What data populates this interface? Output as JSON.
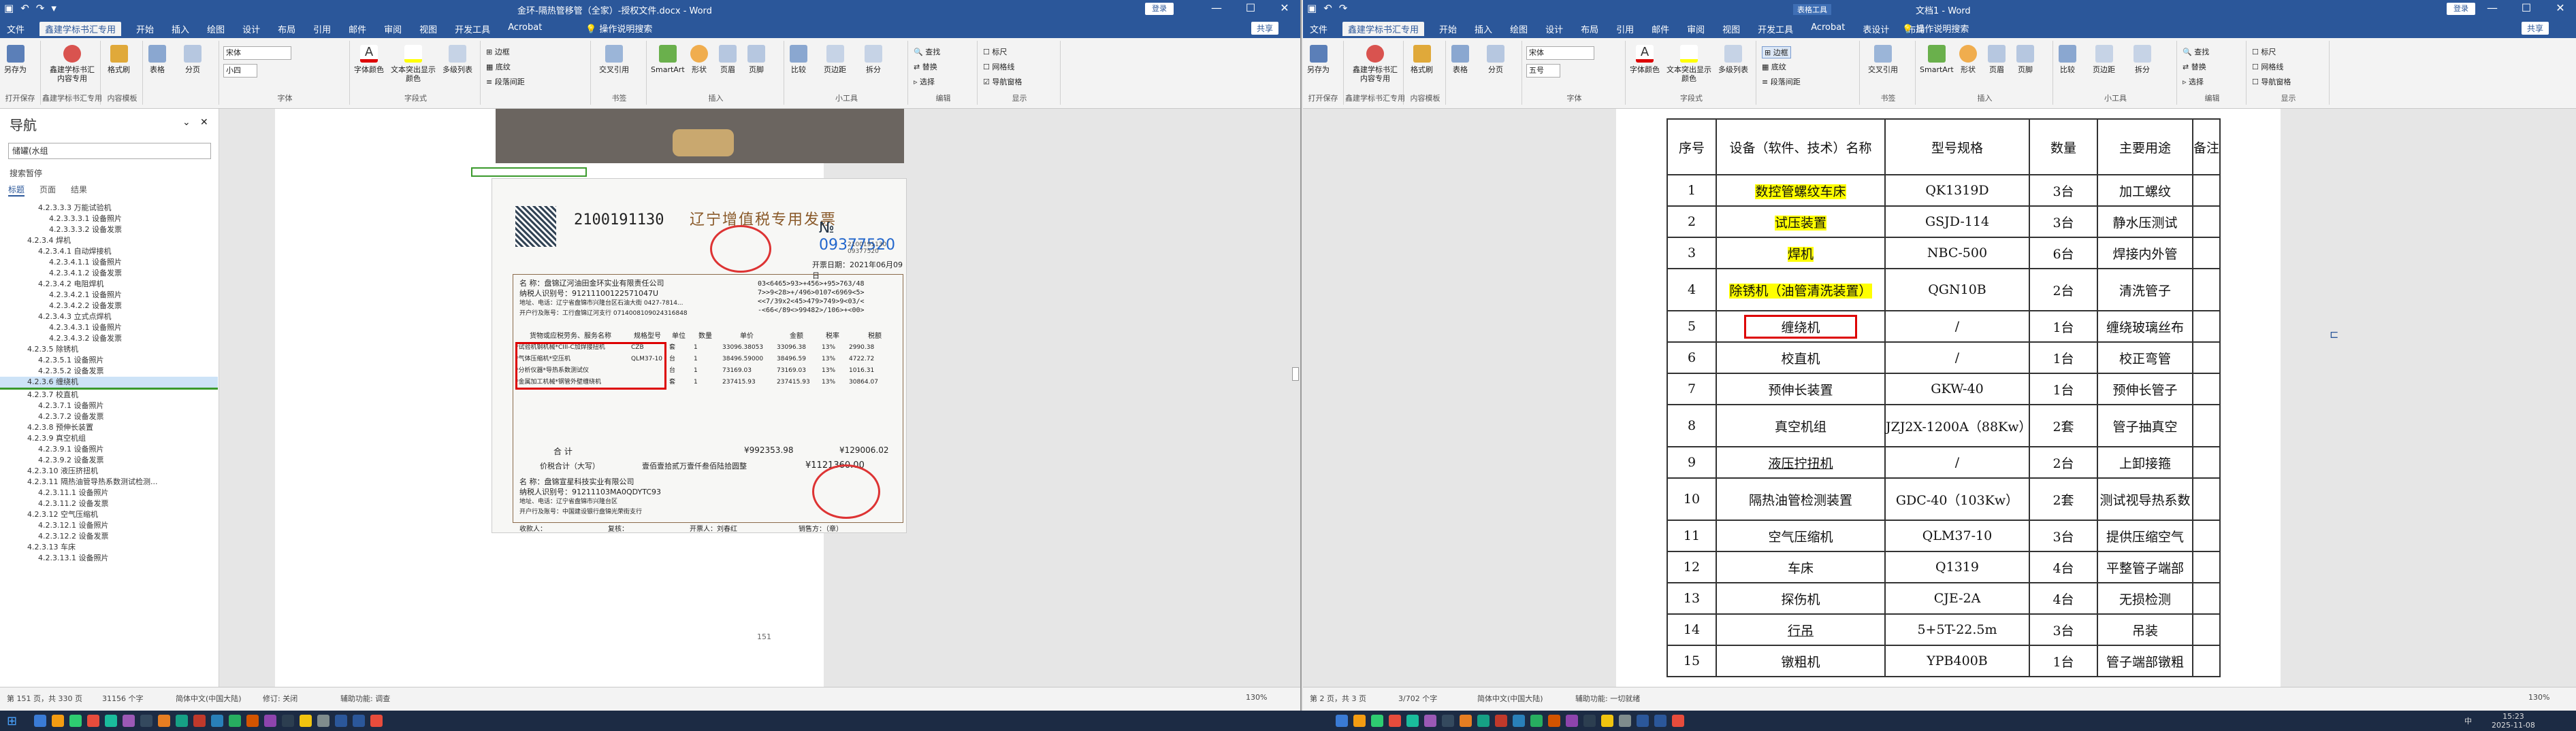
{
  "left": {
    "title": "金环-隔热管移管（全家）-授权文件.docx - Word",
    "login": "登录",
    "share": "共享",
    "tabs": [
      "文件",
      "鑫建学标书汇专用",
      "开始",
      "插入",
      "绘图",
      "设计",
      "布局",
      "引用",
      "邮件",
      "审阅",
      "视图",
      "开发工具",
      "Acrobat"
    ],
    "tellme": "操作说明搜索",
    "ribbon": {
      "save_as": "另存为",
      "template": "鑫建学标书汇内容专用",
      "format_brush": "格式刷",
      "table": "表格",
      "page_break": "分页",
      "font_name": "宋体",
      "font_size": "小四",
      "font_color": "字体颜色",
      "highlight": "文本突出显示颜色",
      "multi": "多级列表",
      "borders": "边框",
      "shading": "底纹",
      "para_spacing": "段落间距",
      "cross_ref": "交叉引用",
      "smartart": "SmartArt",
      "shape": "形状",
      "page": "页眉",
      "footer": "页脚",
      "compare": "比较",
      "page_margin": "页边距",
      "split": "拆分",
      "find": "查找",
      "replace": "替换",
      "select": "选择",
      "ruler": "标尺",
      "gridlines": "网格线",
      "nav_pane": "导航窗格",
      "groups": [
        "打开保存",
        "鑫建学标书汇专用",
        "内容模板",
        "字体",
        "字段式",
        "书签",
        "插入",
        "小工具",
        "编辑",
        "显示"
      ]
    },
    "nav": {
      "title": "导航",
      "search": "储罐(水组",
      "sub": "搜索暂停",
      "tabs": [
        "标题",
        "页面",
        "结果"
      ],
      "tree": [
        {
          "l": "4.2.3.3.3 万能试验机",
          "i": 3
        },
        {
          "l": "4.2.3.3.3.1 设备照片",
          "i": 4
        },
        {
          "l": "4.2.3.3.3.2 设备发票",
          "i": 4
        },
        {
          "l": "4.2.3.4 焊机",
          "i": 2
        },
        {
          "l": "4.2.3.4.1 自动焊接机",
          "i": 3
        },
        {
          "l": "4.2.3.4.1.1 设备照片",
          "i": 4
        },
        {
          "l": "4.2.3.4.1.2 设备发票",
          "i": 4
        },
        {
          "l": "4.2.3.4.2 电阻焊机",
          "i": 3
        },
        {
          "l": "4.2.3.4.2.1 设备照片",
          "i": 4
        },
        {
          "l": "4.2.3.4.2.2 设备发票",
          "i": 4
        },
        {
          "l": "4.2.3.4.3 立式点焊机",
          "i": 3
        },
        {
          "l": "4.2.3.4.3.1 设备照片",
          "i": 4
        },
        {
          "l": "4.2.3.4.3.2 设备发票",
          "i": 4
        },
        {
          "l": "4.2.3.5 除锈机",
          "i": 2
        },
        {
          "l": "4.2.3.5.1 设备照片",
          "i": 3
        },
        {
          "l": "4.2.3.5.2 设备发票",
          "i": 3
        },
        {
          "l": "4.2.3.6 缠绕机",
          "i": 2,
          "sel": true
        },
        {
          "l": "4.2.3.7 校直机",
          "i": 2
        },
        {
          "l": "4.2.3.7.1 设备照片",
          "i": 3
        },
        {
          "l": "4.2.3.7.2 设备发票",
          "i": 3
        },
        {
          "l": "4.2.3.8 预伸长装置",
          "i": 2
        },
        {
          "l": "4.2.3.9 真空机组",
          "i": 2
        },
        {
          "l": "4.2.3.9.1 设备照片",
          "i": 3
        },
        {
          "l": "4.2.3.9.2 设备发票",
          "i": 3
        },
        {
          "l": "4.2.3.10 液压挤扭机",
          "i": 2
        },
        {
          "l": "4.2.3.11 隔热油管导热系数测试检测...",
          "i": 2
        },
        {
          "l": "4.2.3.11.1 设备照片",
          "i": 3
        },
        {
          "l": "4.2.3.11.2 设备发票",
          "i": 3
        },
        {
          "l": "4.2.3.12 空气压缩机",
          "i": 2
        },
        {
          "l": "4.2.3.12.1 设备照片",
          "i": 3
        },
        {
          "l": "4.2.3.12.2 设备发票",
          "i": 3
        },
        {
          "l": "4.2.3.13 车床",
          "i": 2
        },
        {
          "l": "4.2.3.13.1 设备照片",
          "i": 3
        }
      ]
    },
    "invoice": {
      "code": "2100191130",
      "title": "辽宁增值税专用发票",
      "no_prefix": "№",
      "no": "09377520",
      "no_small": "2100191130\n09377520",
      "date": "开票日期：2021年06月09日",
      "buyer_name": "名 称：盘锦辽河油田金环实业有限责任公司",
      "buyer_tax": "纳税人识别号：91211100122571047U",
      "buyer_addr": "地址、电话：辽宁省盘锦市兴隆台区石油大街 0427-7814...",
      "buyer_bank": "开户行及账号：工行盘锦辽河支行 0714008109024316848",
      "cipher": "03<6465>93>+456>+95>763/48\n7>>9<28>+/496>0107<6969<5>\n<<7/39x2<45>479>749>9<03/<\n-<66</89<>99482>/106>+<00>",
      "items_header": [
        "货物或应税劳务、服务名称",
        "规格型号",
        "单位",
        "数量",
        "单价",
        "金额",
        "税率",
        "税额"
      ],
      "items": [
        [
          "*试验机钢机械*CIII-C加焊接扭机",
          "CZB",
          "套",
          "1",
          "33096.38053",
          "33096.38",
          "13%",
          "2990.38"
        ],
        [
          "*气体压缩机*空压机",
          "QLM37-10",
          "台",
          "1",
          "38496.59000",
          "38496.59",
          "13%",
          "4722.72"
        ],
        [
          "*分析仪器*导热系数测试仪",
          "",
          "台",
          "1",
          "73169.03",
          "73169.03",
          "13%",
          "1016.31"
        ],
        [
          "*金属加工机械*钢管外壁缠绕机",
          "",
          "套",
          "1",
          "237415.93",
          "237415.93",
          "13%",
          "30864.07"
        ]
      ],
      "total_label": "合 计",
      "total": "¥992353.98",
      "total_tax": "¥129006.02",
      "amount_label": "价税合计（大写）",
      "amount_text": "壹佰壹拾贰万壹仟叁佰陆拾圆整",
      "amount_num": "¥1121360.00",
      "seller_name": "名 称：盘锦宣星科技实业有限公司",
      "seller_tax": "纳税人识别号：91211103MA0QDYTC93",
      "seller_addr": "地址、电话：辽宁省盘锦市兴隆台区",
      "seller_bank": "开户行及账号：中国建设银行盘锦光荣街支行",
      "payee": "收款人：",
      "reviewer": "复核：",
      "issuer": "开票人：刘春红",
      "seller_label": "销售方：（章）"
    },
    "page_num": "151",
    "status": {
      "page": "第 151 页，共 330 页",
      "words": "31156 个字",
      "lang": "简体中文(中国大陆)",
      "track": "修订: 关闭",
      "access": "辅助功能: 调查",
      "zoom": "130%"
    }
  },
  "right": {
    "title": "文档1 - Word",
    "table_tools": "表格工具",
    "login": "登录",
    "share": "共享",
    "tabs": [
      "文件",
      "鑫建学标书汇专用",
      "开始",
      "插入",
      "绘图",
      "设计",
      "布局",
      "引用",
      "邮件",
      "审阅",
      "视图",
      "开发工具",
      "Acrobat",
      "表设计",
      "布局"
    ],
    "tellme": "操作说明搜索",
    "ribbon": {
      "font_name": "宋体",
      "font_size": "五号",
      "borders": "边框",
      "groups": [
        "打开保存",
        "鑫建学标书汇专用",
        "内容模板",
        "字体",
        "字段式",
        "书签",
        "插入",
        "小工具",
        "编辑",
        "显示"
      ]
    },
    "table": {
      "headers": [
        "序号",
        "设备（软件、技术）名称",
        "型号规格",
        "数量",
        "主要用途",
        "备注"
      ],
      "rows": [
        [
          "1",
          "数控管螺纹车床",
          "QK1319D",
          "3台",
          "加工螺纹",
          ""
        ],
        [
          "2",
          "试压装置",
          "GSJD-114",
          "3台",
          "静水压测试",
          ""
        ],
        [
          "3",
          "焊机",
          "NBC-500",
          "6台",
          "焊接内外管",
          ""
        ],
        [
          "4",
          "除锈机（油管清洗装置）",
          "QGN10B",
          "2台",
          "清洗管子",
          ""
        ],
        [
          "5",
          "缠绕机",
          "/",
          "1台",
          "缠绕玻璃丝布",
          ""
        ],
        [
          "6",
          "校直机",
          "/",
          "1台",
          "校正弯管",
          ""
        ],
        [
          "7",
          "预伸长装置",
          "GKW-40",
          "1台",
          "预伸长管子",
          ""
        ],
        [
          "8",
          "真空机组",
          "JZJ2X-1200A（88Kw）",
          "2套",
          "管子抽真空",
          ""
        ],
        [
          "9",
          "液压拧扭机",
          "/",
          "2台",
          "上卸接箍",
          ""
        ],
        [
          "10",
          "隔热油管检测装置",
          "GDC-40（103Kw）",
          "2套",
          "测试视导热系数",
          ""
        ],
        [
          "11",
          "空气压缩机",
          "QLM37-10",
          "3台",
          "提供压缩空气",
          ""
        ],
        [
          "12",
          "车床",
          "Q1319",
          "4台",
          "平整管子端部",
          ""
        ],
        [
          "13",
          "探伤机",
          "CJE-2A",
          "4台",
          "无损检测",
          ""
        ],
        [
          "14",
          "行吊",
          "5+5T-22.5m",
          "3台",
          "吊装",
          ""
        ],
        [
          "15",
          "镦粗机",
          "YPB400B",
          "1台",
          "管子端部镦粗",
          ""
        ]
      ]
    },
    "status": {
      "page": "第 2 页，共 3 页",
      "words": "3/702 个字",
      "lang": "简体中文(中国大陆)",
      "access": "辅助功能: 一切就绪",
      "zoom": "130%"
    }
  },
  "taskbar": {
    "time": "15:23",
    "date": "2025-11-08",
    "lang": "中"
  },
  "colors": {
    "accent": "#2b579a",
    "highlight": "#ffff00",
    "red": "#d00000"
  }
}
